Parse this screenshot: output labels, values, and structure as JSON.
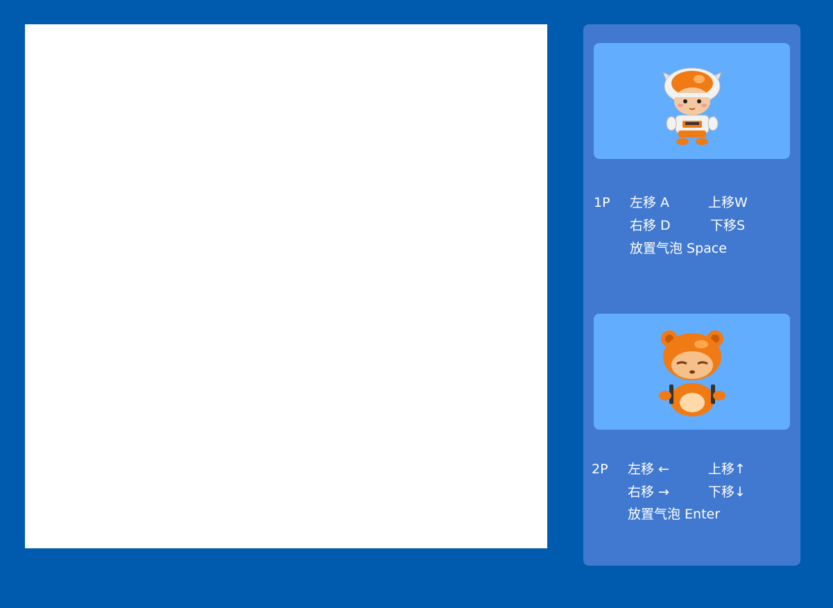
{
  "players": [
    {
      "id": "1P",
      "label": "1P",
      "controls": {
        "left": "左移 A",
        "up": "上移W",
        "right": "右移 D",
        "down": "下移S",
        "bubble": "放置气泡 Space"
      },
      "character_icon": "orange-helmet-kid-icon"
    },
    {
      "id": "2P",
      "label": "2P",
      "controls": {
        "left": "左移 ←",
        "up": "上移↑",
        "right": "右移 →",
        "down": "下移↓",
        "bubble": "放置气泡 Enter"
      },
      "character_icon": "orange-bear-icon"
    }
  ],
  "colors": {
    "background": "#005aad",
    "board": "#ffffff",
    "panel": "#4179d0",
    "portrait_bg": "#63adfe",
    "text": "#ffffff"
  }
}
